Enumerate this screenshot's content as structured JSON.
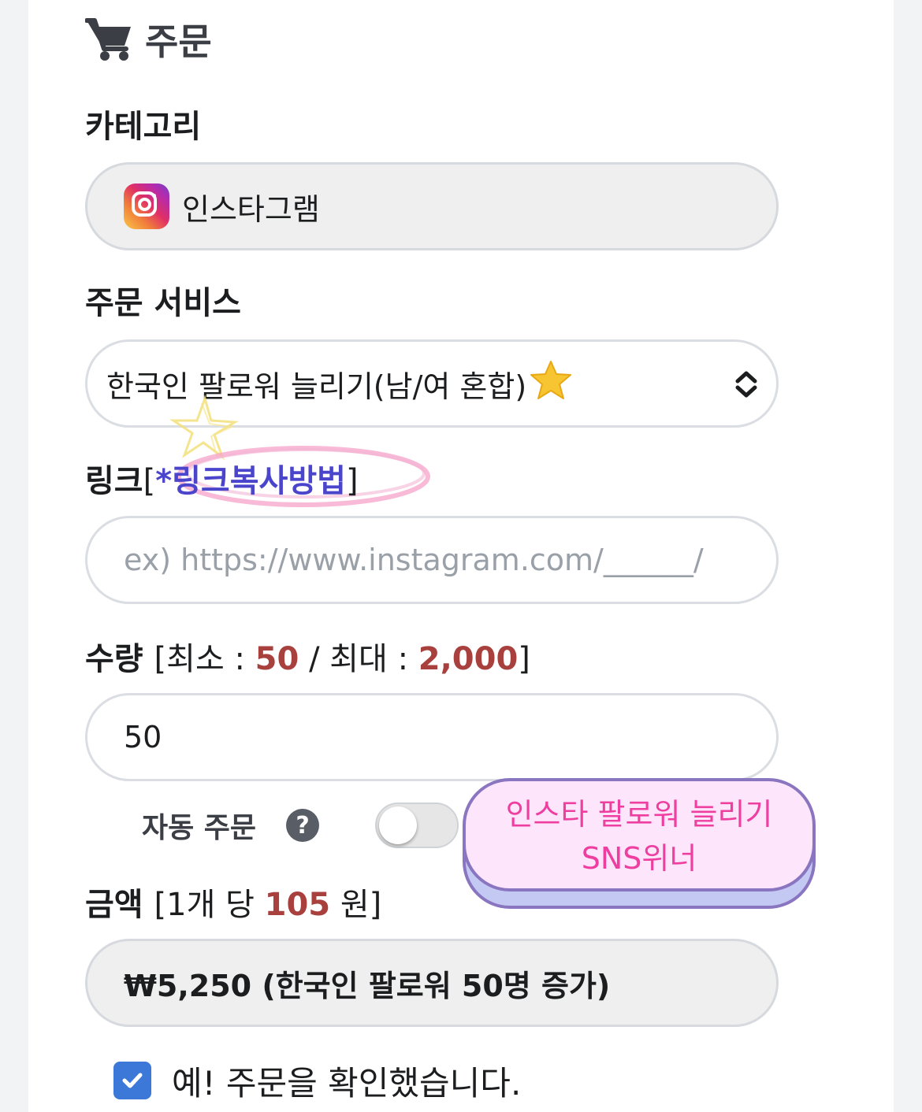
{
  "order": {
    "title": "주문",
    "category_label": "카테고리",
    "category_value": "인스타그램",
    "service_label": "주문 서비스",
    "service_value": "한국인 팔로워 늘리기(남/여 혼합)",
    "link_label": "링크",
    "link_help_text": "*링크복사방법",
    "link_placeholder": "ex) https://www.instagram.com/______/",
    "quantity_label": "수량",
    "quantity_min_label": "최소 :",
    "quantity_min": "50",
    "quantity_max_label": "/ 최대 :",
    "quantity_max": "2,000",
    "quantity_value": "50",
    "auto_order_label": "자동 주문",
    "auto_order_enabled": false,
    "price_label": "금액",
    "price_unit_prefix": "1개 당",
    "price_unit": "105",
    "price_unit_suffix": "원",
    "total_text": "₩5,250 (한국인 팔로워 50명 증가)",
    "confirm_text": "예! 주문을 확인했습니다.",
    "confirm_checked": true
  },
  "sticker": {
    "line1": "인스타 팔로워 늘리기",
    "line2": "SNS위너"
  },
  "icons": {
    "heading": "cart-icon",
    "category": "instagram-icon",
    "service_emoji": "star-icon",
    "help": "question-circle-icon",
    "select": "chevron-up-down-icon",
    "checkbox": "check-icon"
  },
  "colors": {
    "accent_red": "#a8403e",
    "link_blue": "#4b45cc",
    "checkbox_blue": "#3b78d8",
    "sticker_pink": "#ee3ea0"
  }
}
